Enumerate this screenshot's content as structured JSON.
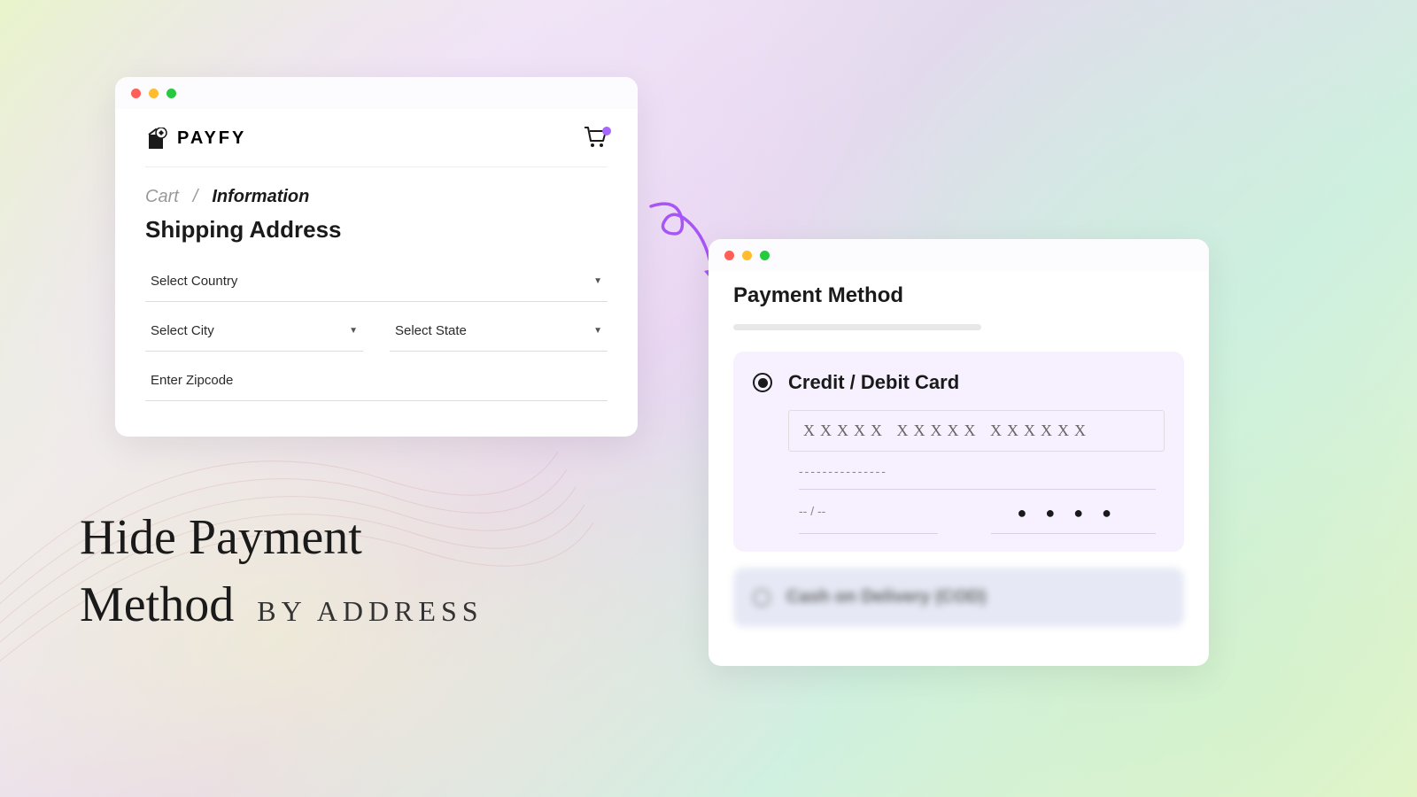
{
  "brand": {
    "name": "PAYFY"
  },
  "breadcrumb": {
    "cart": "Cart",
    "separator": "/",
    "info": "Information"
  },
  "shipping": {
    "title": "Shipping Address",
    "country_placeholder": "Select Country",
    "city_placeholder": "Select City",
    "state_placeholder": "Select State",
    "zip_placeholder": "Enter Zipcode"
  },
  "payment": {
    "title": "Payment Method",
    "card_option": "Credit / Debit Card",
    "card_number_placeholder": "XXXXX XXXXX XXXXXX",
    "card_name_placeholder": "---------------",
    "expiry_placeholder": "-- / --",
    "cvv_placeholder": "● ● ● ●",
    "cod_option": "Cash on Delivery (COD)"
  },
  "headline": {
    "line1": "Hide Payment",
    "line2_main": "Method",
    "line2_sub": "BY ADDRESS"
  }
}
